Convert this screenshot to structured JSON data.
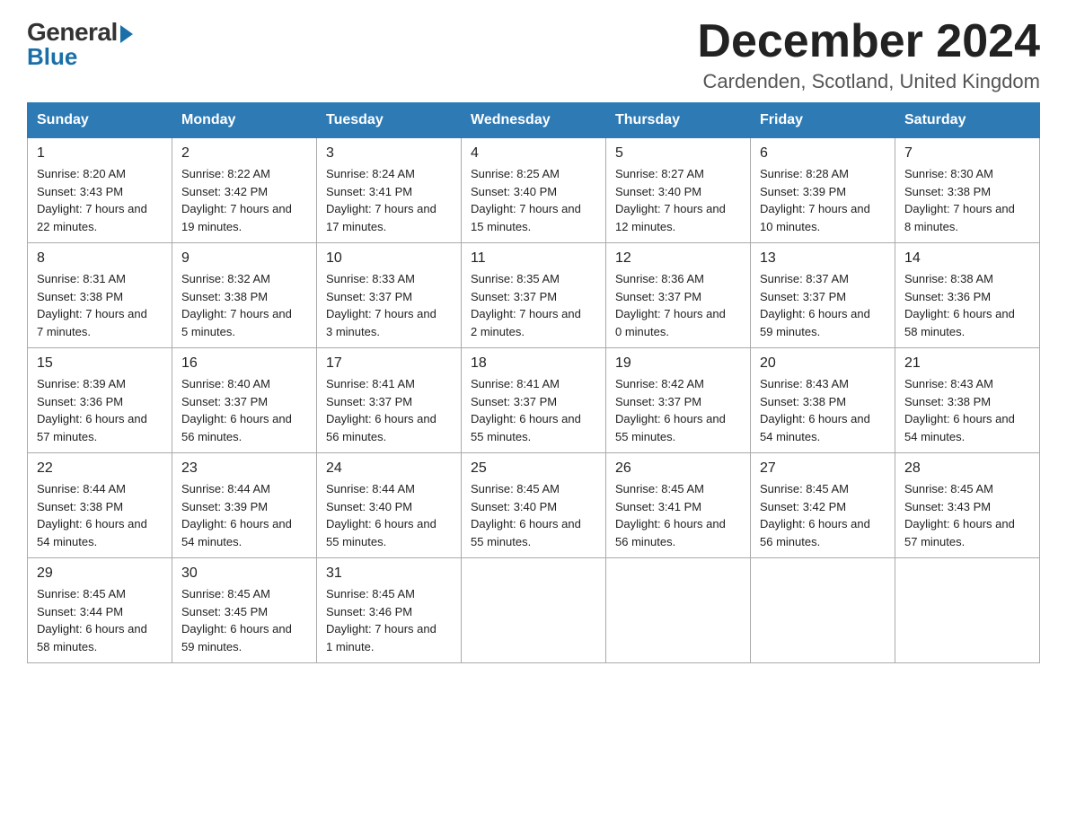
{
  "header": {
    "logo": {
      "general": "General",
      "blue": "Blue"
    },
    "title": "December 2024",
    "location": "Cardenden, Scotland, United Kingdom"
  },
  "calendar": {
    "days_of_week": [
      "Sunday",
      "Monday",
      "Tuesday",
      "Wednesday",
      "Thursday",
      "Friday",
      "Saturday"
    ],
    "weeks": [
      [
        {
          "day": "1",
          "sunrise": "8:20 AM",
          "sunset": "3:43 PM",
          "daylight": "7 hours and 22 minutes."
        },
        {
          "day": "2",
          "sunrise": "8:22 AM",
          "sunset": "3:42 PM",
          "daylight": "7 hours and 19 minutes."
        },
        {
          "day": "3",
          "sunrise": "8:24 AM",
          "sunset": "3:41 PM",
          "daylight": "7 hours and 17 minutes."
        },
        {
          "day": "4",
          "sunrise": "8:25 AM",
          "sunset": "3:40 PM",
          "daylight": "7 hours and 15 minutes."
        },
        {
          "day": "5",
          "sunrise": "8:27 AM",
          "sunset": "3:40 PM",
          "daylight": "7 hours and 12 minutes."
        },
        {
          "day": "6",
          "sunrise": "8:28 AM",
          "sunset": "3:39 PM",
          "daylight": "7 hours and 10 minutes."
        },
        {
          "day": "7",
          "sunrise": "8:30 AM",
          "sunset": "3:38 PM",
          "daylight": "7 hours and 8 minutes."
        }
      ],
      [
        {
          "day": "8",
          "sunrise": "8:31 AM",
          "sunset": "3:38 PM",
          "daylight": "7 hours and 7 minutes."
        },
        {
          "day": "9",
          "sunrise": "8:32 AM",
          "sunset": "3:38 PM",
          "daylight": "7 hours and 5 minutes."
        },
        {
          "day": "10",
          "sunrise": "8:33 AM",
          "sunset": "3:37 PM",
          "daylight": "7 hours and 3 minutes."
        },
        {
          "day": "11",
          "sunrise": "8:35 AM",
          "sunset": "3:37 PM",
          "daylight": "7 hours and 2 minutes."
        },
        {
          "day": "12",
          "sunrise": "8:36 AM",
          "sunset": "3:37 PM",
          "daylight": "7 hours and 0 minutes."
        },
        {
          "day": "13",
          "sunrise": "8:37 AM",
          "sunset": "3:37 PM",
          "daylight": "6 hours and 59 minutes."
        },
        {
          "day": "14",
          "sunrise": "8:38 AM",
          "sunset": "3:36 PM",
          "daylight": "6 hours and 58 minutes."
        }
      ],
      [
        {
          "day": "15",
          "sunrise": "8:39 AM",
          "sunset": "3:36 PM",
          "daylight": "6 hours and 57 minutes."
        },
        {
          "day": "16",
          "sunrise": "8:40 AM",
          "sunset": "3:37 PM",
          "daylight": "6 hours and 56 minutes."
        },
        {
          "day": "17",
          "sunrise": "8:41 AM",
          "sunset": "3:37 PM",
          "daylight": "6 hours and 56 minutes."
        },
        {
          "day": "18",
          "sunrise": "8:41 AM",
          "sunset": "3:37 PM",
          "daylight": "6 hours and 55 minutes."
        },
        {
          "day": "19",
          "sunrise": "8:42 AM",
          "sunset": "3:37 PM",
          "daylight": "6 hours and 55 minutes."
        },
        {
          "day": "20",
          "sunrise": "8:43 AM",
          "sunset": "3:38 PM",
          "daylight": "6 hours and 54 minutes."
        },
        {
          "day": "21",
          "sunrise": "8:43 AM",
          "sunset": "3:38 PM",
          "daylight": "6 hours and 54 minutes."
        }
      ],
      [
        {
          "day": "22",
          "sunrise": "8:44 AM",
          "sunset": "3:38 PM",
          "daylight": "6 hours and 54 minutes."
        },
        {
          "day": "23",
          "sunrise": "8:44 AM",
          "sunset": "3:39 PM",
          "daylight": "6 hours and 54 minutes."
        },
        {
          "day": "24",
          "sunrise": "8:44 AM",
          "sunset": "3:40 PM",
          "daylight": "6 hours and 55 minutes."
        },
        {
          "day": "25",
          "sunrise": "8:45 AM",
          "sunset": "3:40 PM",
          "daylight": "6 hours and 55 minutes."
        },
        {
          "day": "26",
          "sunrise": "8:45 AM",
          "sunset": "3:41 PM",
          "daylight": "6 hours and 56 minutes."
        },
        {
          "day": "27",
          "sunrise": "8:45 AM",
          "sunset": "3:42 PM",
          "daylight": "6 hours and 56 minutes."
        },
        {
          "day": "28",
          "sunrise": "8:45 AM",
          "sunset": "3:43 PM",
          "daylight": "6 hours and 57 minutes."
        }
      ],
      [
        {
          "day": "29",
          "sunrise": "8:45 AM",
          "sunset": "3:44 PM",
          "daylight": "6 hours and 58 minutes."
        },
        {
          "day": "30",
          "sunrise": "8:45 AM",
          "sunset": "3:45 PM",
          "daylight": "6 hours and 59 minutes."
        },
        {
          "day": "31",
          "sunrise": "8:45 AM",
          "sunset": "3:46 PM",
          "daylight": "7 hours and 1 minute."
        },
        null,
        null,
        null,
        null
      ]
    ]
  }
}
